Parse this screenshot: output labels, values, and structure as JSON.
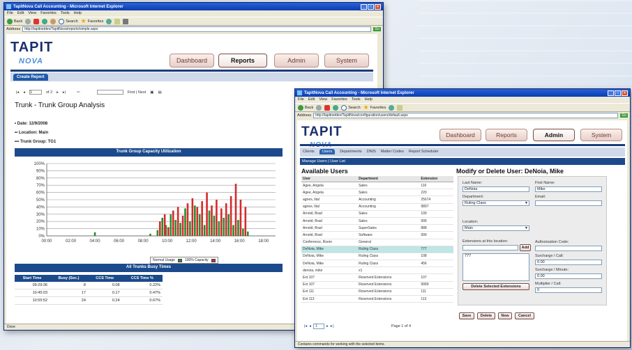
{
  "window1": {
    "title": "TapitNova Call Accounting - Microsoft Internet Explorer",
    "menu": [
      "File",
      "Edit",
      "View",
      "Favorites",
      "Tools",
      "Help"
    ],
    "toolbar": {
      "back": "Back",
      "search": "Search",
      "favorites": "Favorites"
    },
    "address_label": "Address",
    "address": "http://tapitnetdev/TapitNova/reports/simple.aspx",
    "go": "Go",
    "nav": {
      "dashboard": "Dashboard",
      "reports": "Reports",
      "admin": "Admin",
      "system": "System"
    },
    "tab": "Create Report",
    "report_toolbar": {
      "page": "1",
      "of": "of 2",
      "find": "Find | Next"
    },
    "report_title": "Trunk - Trunk Group Analysis",
    "meta": {
      "date": "• Date: 12/9/2008",
      "location": "•• Location: Main",
      "trunk_group": "••• Trunk Group: TG1"
    },
    "chart_bar_title": "Trunk Group Capacity Utilization",
    "legend": {
      "normal": "Normal Usage",
      "capacity": "100% Capacity"
    },
    "table_bar_title": "All Trunks Busy Times",
    "table": {
      "headers": [
        "Start Time",
        "Busy (Sec.)",
        "CCS Time",
        "CCS Time %"
      ],
      "rows": [
        [
          "09:29:36",
          "8",
          "0.08",
          "0.22%"
        ],
        [
          "10:45:03",
          "17",
          "0.17",
          "0.47%"
        ],
        [
          "10:55:52",
          "24",
          "0.24",
          "0.67%"
        ]
      ]
    },
    "status": "Done"
  },
  "chart_data": {
    "type": "bar",
    "title": "Trunk Group Capacity Utilization",
    "ylim": [
      0,
      100
    ],
    "yticks": [
      "100%",
      "90%",
      "80%",
      "70%",
      "60%",
      "50%",
      "40%",
      "30%",
      "20%",
      "10%",
      "0%"
    ],
    "xticks": [
      "00:00",
      "02:00",
      "04:00",
      "06:00",
      "08:00",
      "10:00",
      "12:00",
      "14:00",
      "16:00",
      "18:00"
    ],
    "xlim": [
      0,
      19
    ],
    "series": [
      {
        "name": "Normal Usage",
        "color": "#2e8b2e",
        "x": [
          4.0,
          8.6,
          9.2,
          9.6,
          9.9,
          10.3,
          10.7,
          11.1,
          11.5,
          11.9,
          12.3,
          12.7,
          13.1,
          13.5,
          13.9,
          14.3,
          14.7,
          15.1,
          15.5,
          15.9,
          16.3,
          16.7
        ],
        "values": [
          5,
          3,
          8,
          25,
          15,
          30,
          22,
          18,
          38,
          20,
          42,
          30,
          15,
          35,
          28,
          20,
          25,
          30,
          15,
          22,
          10,
          6
        ]
      },
      {
        "name": "100% Capacity",
        "color": "#d42b2b",
        "x": [
          9.4,
          9.8,
          10.1,
          10.5,
          10.9,
          11.3,
          11.7,
          12.1,
          12.5,
          12.9,
          13.3,
          13.7,
          14.1,
          14.5,
          14.9,
          15.3,
          15.7,
          16.1,
          16.5
        ],
        "values": [
          20,
          30,
          12,
          35,
          40,
          28,
          45,
          52,
          40,
          48,
          60,
          42,
          50,
          38,
          45,
          55,
          72,
          50,
          40
        ]
      }
    ]
  },
  "window2": {
    "title": "TapitNova Call Accounting - Microsoft Internet Explorer",
    "address": "http://tapitnetdev/TapitNova/configuration/users/default.aspx",
    "nav": {
      "dashboard": "Dashboard",
      "reports": "Reports",
      "admin": "Admin",
      "system": "System"
    },
    "subtabs": [
      "Clients",
      "Users",
      "Departments",
      "DNIS",
      "Matter Codes",
      "Report Scheduler"
    ],
    "subnav": "Manage Users | User List",
    "available_users": "Available Users",
    "users_headers": [
      "User",
      "Department",
      "Extension"
    ],
    "users": [
      [
        "Agee, Angela",
        "Sales",
        "110"
      ],
      [
        "Agee, Angela",
        "Sales",
        "220"
      ],
      [
        "agnes, lital",
        "Accounting",
        "25674"
      ],
      [
        "agnes, lital",
        "Accounting",
        "9897"
      ],
      [
        "Arnold, Brad",
        "Sales",
        "109"
      ],
      [
        "Arnold, Brad",
        "Sales",
        "999"
      ],
      [
        "Arnold, Brad",
        "SuperSales",
        "888"
      ],
      [
        "Arnold, Brad",
        "Software",
        "999"
      ],
      [
        "Conference, Room",
        "General",
        ""
      ],
      [
        "DeNoia, Mike",
        "Ruling Class",
        "777"
      ],
      [
        "DeNoia, Mike",
        "Ruling Class",
        "108"
      ],
      [
        "DeNoia, Mike",
        "Ruling Class",
        "456"
      ],
      [
        "denoia, mike",
        "x1",
        ""
      ],
      [
        "Ext 107",
        "Reserved Extensions",
        "107"
      ],
      [
        "Ext 107",
        "Reserved Extensions",
        "9999"
      ],
      [
        "Ext 111",
        "Reserved Extensions",
        "111"
      ],
      [
        "Ext 113",
        "Reserved Extensions",
        "113"
      ]
    ],
    "pager": {
      "page": "1",
      "info": "Page 1 of 4"
    },
    "form_title": "Modify or Delete User: DeNoia, Mike",
    "form": {
      "last_name_label": "Last Name:",
      "last_name": "DeNoia",
      "first_name_label": "First Name:",
      "first_name": "Mike",
      "department_label": "Department:",
      "department": "Ruling Class",
      "email_label": "Email:",
      "email": "",
      "location_label": "Location:",
      "location": "Main",
      "extensions_label": "Extensions at this location:",
      "add": "Add",
      "extension_item": "777",
      "auth_label": "Authorization Code:",
      "surcharge_call_label": "Surcharge / Call:",
      "surcharge_call": "0.00",
      "surcharge_min_label": "Surcharge / Minute:",
      "surcharge_min": "0.00",
      "multiplier_label": "Multiplier / Call:",
      "multiplier": "0",
      "delete_ext": "Delete Selected Extensions"
    },
    "buttons": {
      "save": "Save",
      "delete": "Delete",
      "new": "New",
      "cancel": "Cancel"
    },
    "status": "Contains commands for working with the selected items."
  },
  "colors": {
    "navy": "#1b4a8c",
    "green": "#2e8b2e",
    "red": "#d42b2b",
    "highlight": "#bfe5e5"
  }
}
